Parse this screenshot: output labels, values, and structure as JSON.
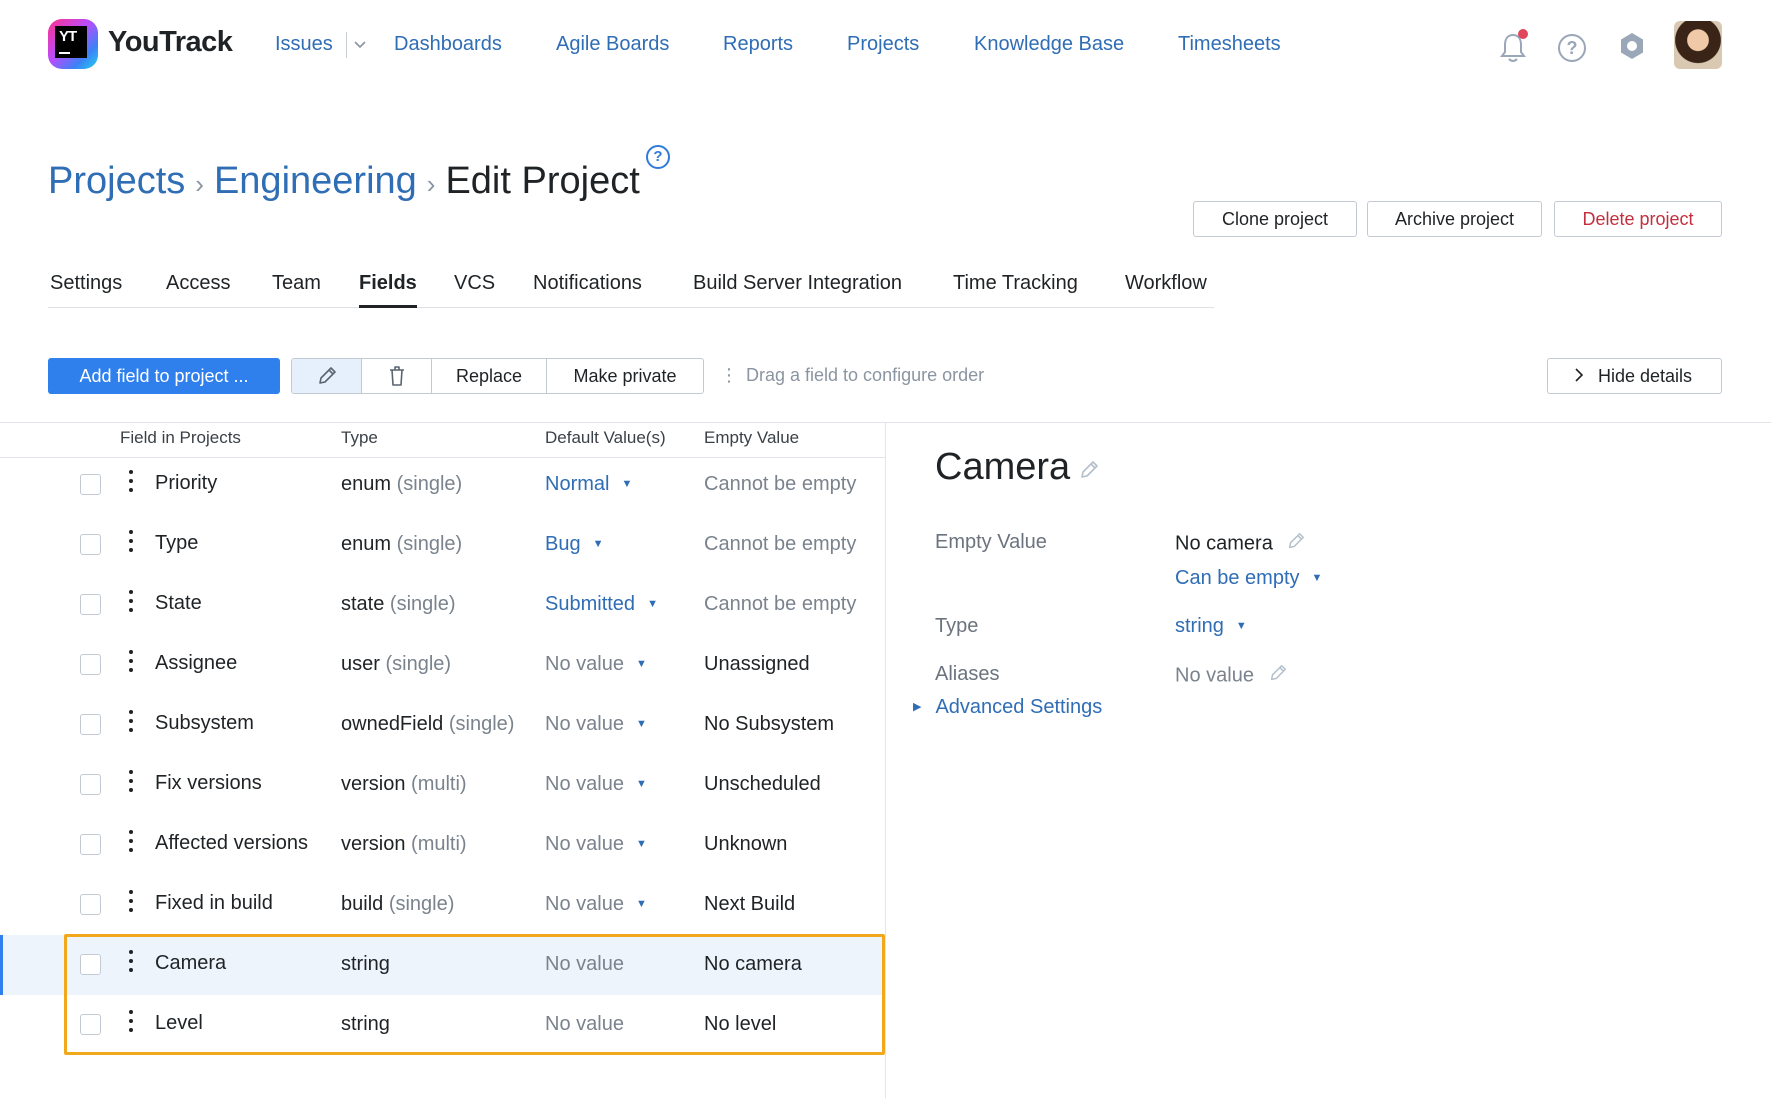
{
  "app": {
    "brand": "YouTrack"
  },
  "nav": {
    "issues": "Issues",
    "dashboards": "Dashboards",
    "agile_boards": "Agile Boards",
    "reports": "Reports",
    "projects": "Projects",
    "knowledge_base": "Knowledge Base",
    "timesheets": "Timesheets"
  },
  "breadcrumb": {
    "projects": "Projects",
    "engineering": "Engineering",
    "current": "Edit Project"
  },
  "header_buttons": {
    "clone": "Clone project",
    "archive": "Archive project",
    "delete": "Delete project"
  },
  "tabs": [
    "Settings",
    "Access",
    "Team",
    "Fields",
    "VCS",
    "Notifications",
    "Build Server Integration",
    "Time Tracking",
    "Workflow"
  ],
  "active_tab": "Fields",
  "toolbar": {
    "add_field": "Add field to project ...",
    "replace": "Replace",
    "make_private": "Make private",
    "drag_hint": "Drag a field to configure order",
    "hide_details": "Hide details"
  },
  "table": {
    "headers": {
      "field": "Field in Projects",
      "type": "Type",
      "default": "Default Value(s)",
      "empty": "Empty Value"
    },
    "rows": [
      {
        "name": "Priority",
        "type": "enum",
        "modifier": "(single)",
        "default": "Normal",
        "default_set": true,
        "empty": "Cannot be empty",
        "empty_muted": true
      },
      {
        "name": "Type",
        "type": "enum",
        "modifier": "(single)",
        "default": "Bug",
        "default_set": true,
        "empty": "Cannot be empty",
        "empty_muted": true
      },
      {
        "name": "State",
        "type": "state",
        "modifier": "(single)",
        "default": "Submitted",
        "default_set": true,
        "empty": "Cannot be empty",
        "empty_muted": true
      },
      {
        "name": "Assignee",
        "type": "user",
        "modifier": "(single)",
        "default": "No value",
        "default_set": false,
        "empty": "Unassigned",
        "empty_muted": false
      },
      {
        "name": "Subsystem",
        "type": "ownedField",
        "modifier": "(single)",
        "default": "No value",
        "default_set": false,
        "empty": "No Subsystem",
        "empty_muted": false
      },
      {
        "name": "Fix versions",
        "type": "version",
        "modifier": "(multi)",
        "default": "No value",
        "default_set": false,
        "empty": "Unscheduled",
        "empty_muted": false
      },
      {
        "name": "Affected versions",
        "type": "version",
        "modifier": "(multi)",
        "default": "No value",
        "default_set": false,
        "empty": "Unknown",
        "empty_muted": false
      },
      {
        "name": "Fixed in build",
        "type": "build",
        "modifier": "(single)",
        "default": "No value",
        "default_set": false,
        "empty": "Next Build",
        "empty_muted": false
      },
      {
        "name": "Camera",
        "type": "string",
        "modifier": "",
        "default": "No value",
        "default_set": false,
        "no_caret": true,
        "empty": "No camera",
        "empty_muted": false,
        "selected": true
      },
      {
        "name": "Level",
        "type": "string",
        "modifier": "",
        "default": "No value",
        "default_set": false,
        "no_caret": true,
        "empty": "No level",
        "empty_muted": false
      }
    ]
  },
  "details": {
    "title": "Camera",
    "empty_value_label": "Empty Value",
    "empty_value": "No camera",
    "can_be_empty": "Can be empty",
    "type_label": "Type",
    "type_value": "string",
    "aliases_label": "Aliases",
    "aliases_value": "No value",
    "advanced": "Advanced Settings"
  },
  "colors": {
    "link": "#2f6db5",
    "primary": "#2f80ed",
    "highlight": "#f2a81d",
    "danger": "#c22f3e",
    "notification_dot": "#e0475b"
  }
}
